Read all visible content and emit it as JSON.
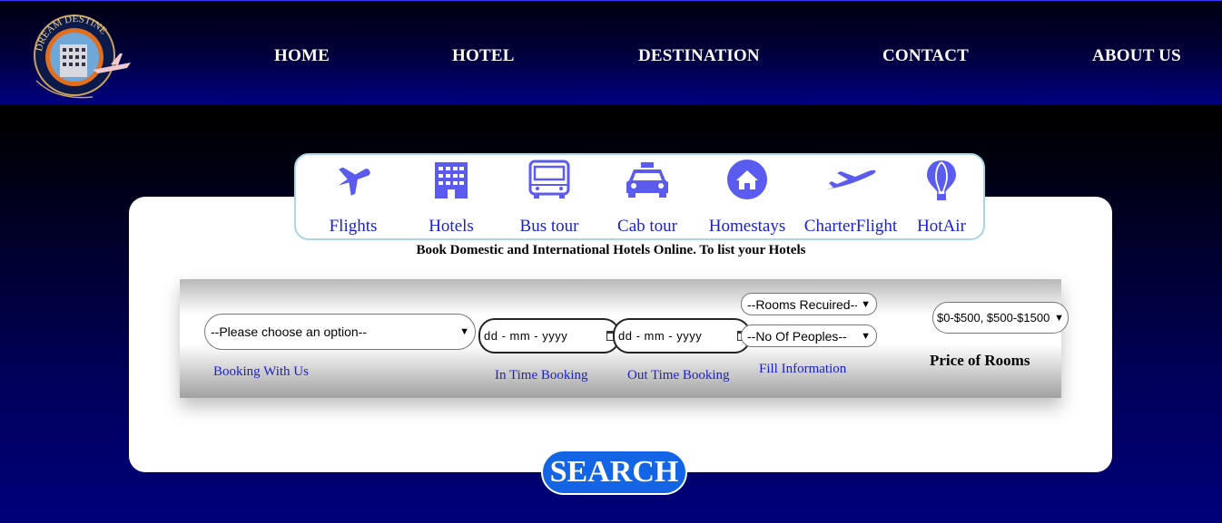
{
  "brand": {
    "logo_text": "DREAM DESTINE"
  },
  "nav": {
    "home": "HOME",
    "hotel": "HOTEL",
    "destination": "DESTINATION",
    "contact": "CONTACT",
    "about": "ABOUT US"
  },
  "categories": [
    {
      "label": "Flights",
      "icon": "airplane-icon"
    },
    {
      "label": "Hotels",
      "icon": "hotel-building-icon"
    },
    {
      "label": "Bus tour",
      "icon": "bus-icon"
    },
    {
      "label": "Cab tour",
      "icon": "taxi-icon"
    },
    {
      "label": "Homestays",
      "icon": "home-icon"
    },
    {
      "label": "CharterFlight",
      "icon": "plane-takeoff-icon"
    },
    {
      "label": "HotAir",
      "icon": "hot-air-balloon-icon"
    }
  ],
  "headline": "Book Domestic and International Hotels Online. To list your Hotels",
  "form": {
    "booking_select": "--Please choose an option--",
    "booking_label": "Booking With Us",
    "in_date": "dd - mm - yyyy",
    "in_label": "In Time Booking",
    "out_date": "dd - mm - yyyy",
    "out_label": "Out Time Booking",
    "rooms_select": "--Rooms Recuired--",
    "people_select": "--No Of Peoples--",
    "fill_label": "Fill Information",
    "price_select": "$0-$500, $500-$1500",
    "price_label": "Price of Rooms"
  },
  "search_label": "SEARCH",
  "colors": {
    "accent_blue": "#1464e6",
    "icon_blue": "#5b5bf0",
    "link_blue": "#1a22d0",
    "nav_bg": "#000080"
  }
}
